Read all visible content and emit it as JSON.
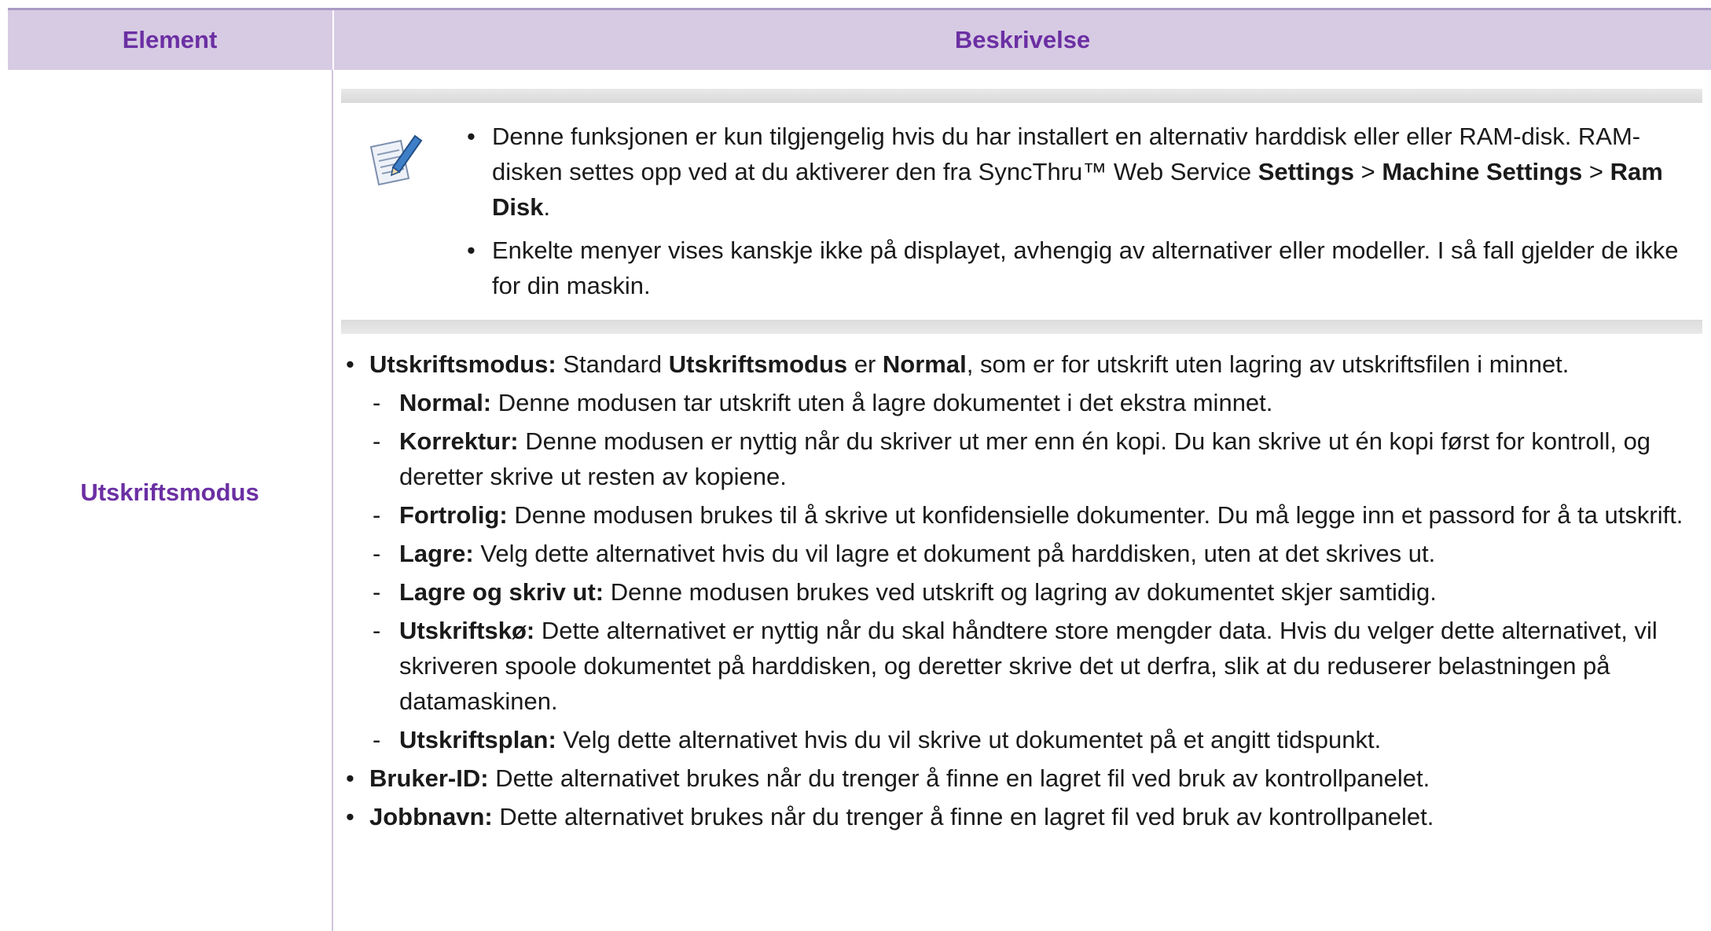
{
  "header": {
    "element": "Element",
    "description": "Beskrivelse"
  },
  "row": {
    "element": "Utskriftsmodus",
    "note_icon": "note-pencil-icon",
    "note": {
      "item1": {
        "text1": "Denne funksjonen er kun tilgjengelig hvis du har installert en alternativ harddisk eller eller RAM-disk. RAM-disken settes opp ved at du aktiverer den fra SyncThru™ Web Service ",
        "bold1": "Settings",
        "sep1": " > ",
        "bold2": "Machine Settings",
        "sep2": " > ",
        "bold3": "Ram Disk",
        "end": "."
      },
      "item2": "Enkelte menyer vises kanskje ikke på displayet, avhengig av alternativer eller modeller. I så fall gjelder de ikke for din maskin."
    },
    "mode": {
      "label": "Utskriftsmodus:",
      "text1": " Standard ",
      "bold1": "Utskriftsmodus",
      "text2": " er ",
      "bold2": "Normal",
      "text3": ", som er for utskrift uten lagring av utskriftsfilen i minnet."
    },
    "sub": [
      {
        "label": "Normal:",
        "text": " Denne modusen tar utskrift uten å lagre dokumentet i det ekstra minnet."
      },
      {
        "label": "Korrektur:",
        "text": " Denne modusen er nyttig når du skriver ut mer enn én kopi. Du kan skrive ut én kopi først for kontroll, og deretter skrive ut resten av kopiene."
      },
      {
        "label": "Fortrolig:",
        "text": " Denne modusen brukes til å skrive ut konfidensielle dokumenter. Du må legge inn et passord for å ta utskrift."
      },
      {
        "label": "Lagre:",
        "text": " Velg dette alternativet hvis du vil lagre et dokument på harddisken, uten at det skrives ut."
      },
      {
        "label": "Lagre og skriv ut:",
        "text": " Denne modusen brukes ved utskrift og lagring av dokumentet skjer samtidig."
      },
      {
        "label": "Utskriftskø:",
        "text": " Dette alternativet er nyttig når du skal håndtere store mengder data. Hvis du velger dette alternativet, vil skriveren spoole dokumentet på harddisken, og deretter skrive det ut derfra, slik at du reduserer belastningen på datamaskinen."
      },
      {
        "label": "Utskriftsplan:",
        "text": " Velg dette alternativet hvis du vil skrive ut dokumentet på et angitt tidspunkt."
      }
    ],
    "userid": {
      "label": "Bruker-ID:",
      "text": " Dette alternativet brukes når du trenger å finne en lagret fil ved bruk av kontrollpanelet."
    },
    "jobname": {
      "label": "Jobbnavn:",
      "text": " Dette alternativet brukes når du trenger å finne en lagret fil ved bruk av kontrollpanelet."
    }
  }
}
